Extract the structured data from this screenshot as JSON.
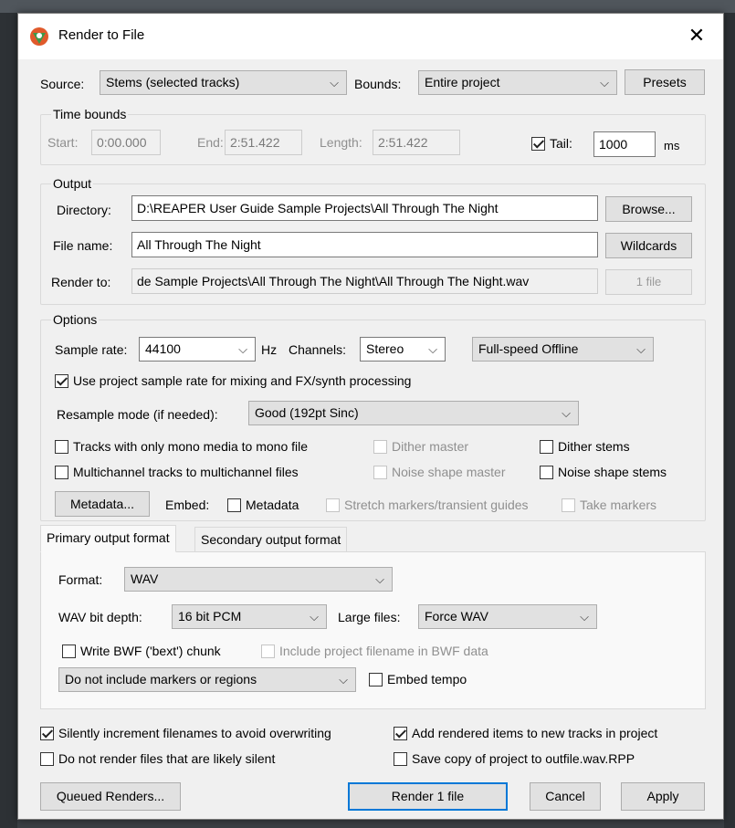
{
  "dialog": {
    "title": "Render to File",
    "close_symbol": "✕"
  },
  "source": {
    "label": "Source:",
    "value": "Stems (selected tracks)",
    "bounds_label": "Bounds:",
    "bounds_value": "Entire project",
    "presets_label": "Presets"
  },
  "time_bounds": {
    "title": "Time bounds",
    "start_label": "Start:",
    "start_value": "0:00.000",
    "end_label": "End:",
    "end_value": "2:51.422",
    "length_label": "Length:",
    "length_value": "2:51.422",
    "tail_label": "Tail:",
    "tail_checked": true,
    "tail_value": "1000",
    "tail_unit": "ms"
  },
  "output": {
    "title": "Output",
    "directory_label": "Directory:",
    "directory_value": "D:\\REAPER User Guide Sample Projects\\All Through The Night",
    "browse_label": "Browse...",
    "filename_label": "File name:",
    "filename_value": "All Through The Night",
    "wildcards_label": "Wildcards",
    "render_to_label": "Render to:",
    "render_to_value": "de Sample Projects\\All Through The Night\\All Through The Night.wav",
    "file_count_label": "1 file"
  },
  "options": {
    "title": "Options",
    "sample_rate_label": "Sample rate:",
    "sample_rate_value": "44100",
    "hz_label": "Hz",
    "channels_label": "Channels:",
    "channels_value": "Stereo",
    "speed_value": "Full-speed Offline",
    "use_project_rate_label": "Use project sample rate for mixing and FX/synth processing",
    "resample_label": "Resample mode (if needed):",
    "resample_value": "Good (192pt Sinc)",
    "mono_label": "Tracks with only mono media to mono file",
    "dither_master_label": "Dither master",
    "dither_stems_label": "Dither stems",
    "multichannel_label": "Multichannel tracks to multichannel files",
    "noise_master_label": "Noise shape master",
    "noise_stems_label": "Noise shape stems",
    "metadata_button": "Metadata...",
    "embed_label": "Embed:",
    "embed_metadata_label": "Metadata",
    "stretch_markers_label": "Stretch markers/transient guides",
    "take_markers_label": "Take markers"
  },
  "tabs": {
    "primary": "Primary output format",
    "secondary": "Secondary output format"
  },
  "format": {
    "format_label": "Format:",
    "format_value": "WAV",
    "bit_depth_label": "WAV bit depth:",
    "bit_depth_value": "16 bit PCM",
    "large_files_label": "Large files:",
    "large_files_value": "Force WAV",
    "bwf_label": "Write BWF ('bext') chunk",
    "include_filename_label": "Include project filename in BWF data",
    "markers_value": "Do not include markers or regions",
    "embed_tempo_label": "Embed tempo"
  },
  "bottom": {
    "silently_increment_label": "Silently increment filenames to avoid overwriting",
    "add_rendered_label": "Add rendered items to new tracks in project",
    "silent_label": "Do not render files that are likely silent",
    "save_copy_label": "Save copy of project to outfile.wav.RPP",
    "queued_label": "Queued Renders...",
    "render_label": "Render 1 file",
    "cancel_label": "Cancel",
    "apply_label": "Apply"
  },
  "icons": {
    "app": "reaper-logo-icon",
    "chevron": "⌵"
  },
  "colors": {
    "dialog_bg": "#f0f0f0",
    "accent": "#0078d7",
    "logo_red": "#e05a2b",
    "logo_green": "#3a9a4a"
  }
}
